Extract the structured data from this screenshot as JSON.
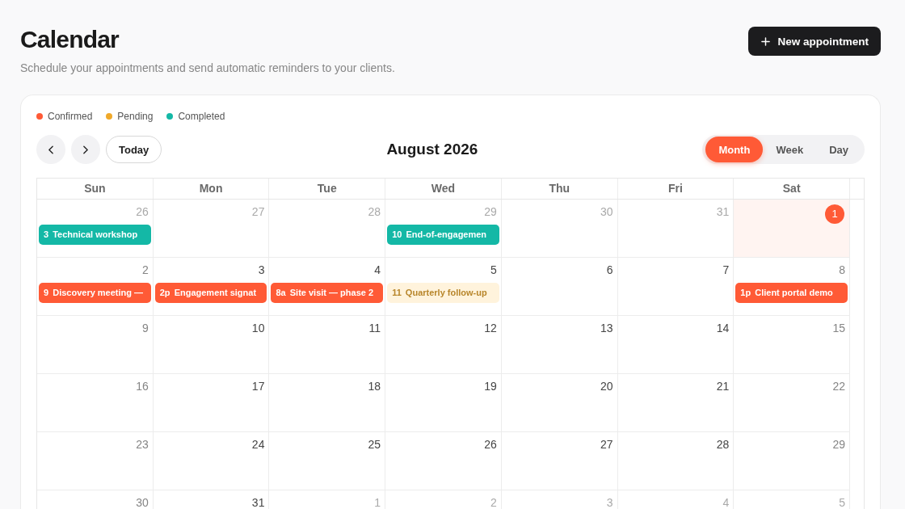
{
  "header": {
    "title": "Calendar",
    "subtitle": "Schedule your appointments and send automatic reminders to your clients.",
    "action": {
      "label": "New appointment"
    }
  },
  "legend": [
    {
      "label": "Confirmed",
      "color": "#ff5a36"
    },
    {
      "label": "Pending",
      "color": "#f0a92a"
    },
    {
      "label": "Completed",
      "color": "#14b8a6"
    }
  ],
  "toolbar": {
    "today_button": "Today",
    "month": "August 2026",
    "views": [
      {
        "label": "Month",
        "selected": true
      },
      {
        "label": "Week",
        "selected": false
      },
      {
        "label": "Day",
        "selected": false
      }
    ]
  },
  "weekdays": [
    "Sun",
    "Mon",
    "Tue",
    "Wed",
    "Thu",
    "Fri",
    "Sat"
  ],
  "weeks": [
    {
      "days": [
        {
          "date": "26",
          "in_month": false,
          "today": false,
          "events": [
            {
              "time": "3",
              "title": "Technical workshop",
              "kind": "completed"
            }
          ]
        },
        {
          "date": "27",
          "in_month": false,
          "today": false
        },
        {
          "date": "28",
          "in_month": false,
          "today": false
        },
        {
          "date": "29",
          "in_month": false,
          "today": false,
          "events": [
            {
              "time": "10",
              "title": "End-of-engagemen",
              "kind": "completed"
            }
          ]
        },
        {
          "date": "30",
          "in_month": false,
          "today": false
        },
        {
          "date": "31",
          "in_month": false,
          "today": false
        },
        {
          "date": "1",
          "in_month": true,
          "today": true
        }
      ]
    },
    {
      "days": [
        {
          "date": "2",
          "in_month": true,
          "today": false,
          "events": [
            {
              "time": "9",
              "title": "Discovery meeting —",
              "kind": "confirmed"
            }
          ]
        },
        {
          "date": "3",
          "in_month": true,
          "today": false,
          "events": [
            {
              "time": "2p",
              "title": "Engagement signat",
              "kind": "confirmed"
            }
          ]
        },
        {
          "date": "4",
          "in_month": true,
          "today": false,
          "events": [
            {
              "time": "8a",
              "title": "Site visit — phase 2",
              "kind": "confirmed"
            }
          ]
        },
        {
          "date": "5",
          "in_month": true,
          "today": false,
          "events": [
            {
              "time": "11",
              "title": "Quarterly follow-up",
              "kind": "pending"
            }
          ]
        },
        {
          "date": "6",
          "in_month": true,
          "today": false
        },
        {
          "date": "7",
          "in_month": true,
          "today": false
        },
        {
          "date": "8",
          "in_month": true,
          "today": false,
          "events": [
            {
              "time": "1p",
              "title": "Client portal demo",
              "kind": "confirmed"
            }
          ]
        }
      ]
    },
    {
      "days": [
        {
          "date": "9",
          "in_month": true,
          "today": false
        },
        {
          "date": "10",
          "in_month": true,
          "today": false
        },
        {
          "date": "11",
          "in_month": true,
          "today": false
        },
        {
          "date": "12",
          "in_month": true,
          "today": false
        },
        {
          "date": "13",
          "in_month": true,
          "today": false
        },
        {
          "date": "14",
          "in_month": true,
          "today": false
        },
        {
          "date": "15",
          "in_month": true,
          "today": false
        }
      ]
    },
    {
      "days": [
        {
          "date": "16",
          "in_month": true,
          "today": false
        },
        {
          "date": "17",
          "in_month": true,
          "today": false
        },
        {
          "date": "18",
          "in_month": true,
          "today": false
        },
        {
          "date": "19",
          "in_month": true,
          "today": false
        },
        {
          "date": "20",
          "in_month": true,
          "today": false
        },
        {
          "date": "21",
          "in_month": true,
          "today": false
        },
        {
          "date": "22",
          "in_month": true,
          "today": false
        }
      ]
    },
    {
      "days": [
        {
          "date": "23",
          "in_month": true,
          "today": false
        },
        {
          "date": "24",
          "in_month": true,
          "today": false
        },
        {
          "date": "25",
          "in_month": true,
          "today": false
        },
        {
          "date": "26",
          "in_month": true,
          "today": false
        },
        {
          "date": "27",
          "in_month": true,
          "today": false
        },
        {
          "date": "28",
          "in_month": true,
          "today": false
        },
        {
          "date": "29",
          "in_month": true,
          "today": false
        }
      ]
    },
    {
      "days": [
        {
          "date": "30",
          "in_month": true,
          "today": false
        },
        {
          "date": "31",
          "in_month": true,
          "today": false
        },
        {
          "date": "1",
          "in_month": false,
          "today": false
        },
        {
          "date": "2",
          "in_month": false,
          "today": false
        },
        {
          "date": "3",
          "in_month": false,
          "today": false
        },
        {
          "date": "4",
          "in_month": false,
          "today": false
        },
        {
          "date": "5",
          "in_month": false,
          "today": false
        }
      ]
    }
  ]
}
